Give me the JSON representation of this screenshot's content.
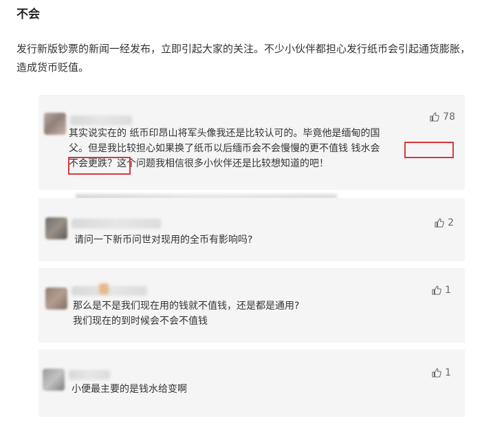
{
  "heading": "不会",
  "intro": "发行新版钞票的新闻一经发布，立即引起大家的关注。不少小伙伴都担心发行纸币会引起通货膨胀，造成货币贬值。",
  "comments": [
    {
      "likes": "78",
      "line1": "其实说实在的  纸币印昂山将军头像我还是比较认可的。毕竟他是缅甸的国",
      "line2": "父。但是我比较担心如果换了纸币以后缅币会不会慢慢的更不值钱  钱水会",
      "line3": "不会更跌？这个问题我相信很多小伙伴还是比较想知道的吧！"
    },
    {
      "likes": "2",
      "line1": "请问一下新币问世对现用的全币有影响吗?"
    },
    {
      "likes": "1",
      "line1": "那么是不是我们现在用的钱就不值钱，还是都是通用?",
      "line2": "我们现在的到时候会不会不值钱"
    },
    {
      "likes": "1",
      "line1": "小便最主要的是钱水给变啊"
    }
  ],
  "colors": {
    "highlight": "#d9363e",
    "card_bg": "#f5f5f5"
  },
  "icons": {
    "like": "thumbs-up-icon"
  }
}
